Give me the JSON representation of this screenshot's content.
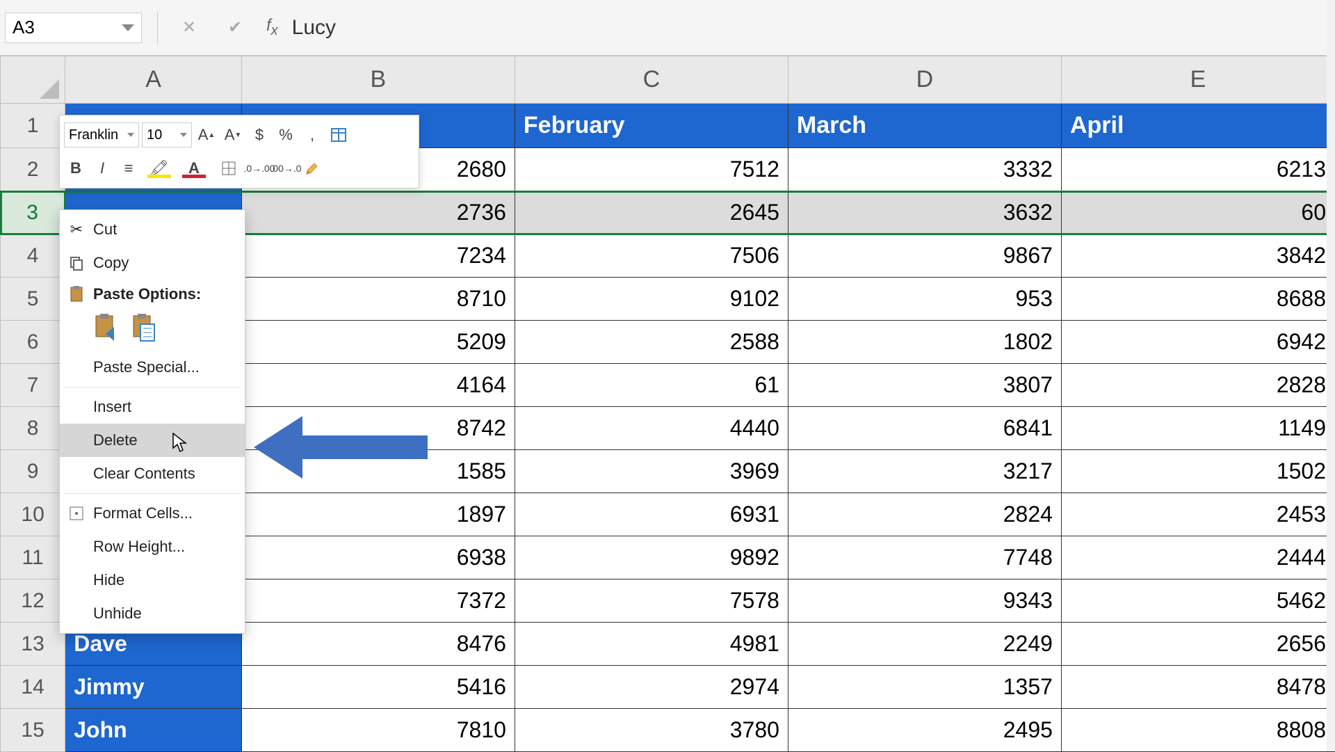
{
  "formula_bar": {
    "name_box": "A3",
    "formula_value": "Lucy"
  },
  "columns": [
    "A",
    "B",
    "C",
    "D",
    "E"
  ],
  "header_row": {
    "a": "",
    "b": "",
    "c": "February",
    "d": "March",
    "e": "April"
  },
  "rows": [
    {
      "n": "1"
    },
    {
      "n": "2",
      "b": "2680",
      "c": "7512",
      "d": "3332",
      "e": "6213"
    },
    {
      "n": "3",
      "b": "2736",
      "c": "2645",
      "d": "3632",
      "e": "60"
    },
    {
      "n": "4",
      "b": "7234",
      "c": "7506",
      "d": "9867",
      "e": "3842"
    },
    {
      "n": "5",
      "b": "8710",
      "c": "9102",
      "d": "953",
      "e": "8688"
    },
    {
      "n": "6",
      "b": "5209",
      "c": "2588",
      "d": "1802",
      "e": "6942"
    },
    {
      "n": "7",
      "b": "4164",
      "c": "61",
      "d": "3807",
      "e": "2828"
    },
    {
      "n": "8",
      "b": "8742",
      "c": "4440",
      "d": "6841",
      "e": "1149"
    },
    {
      "n": "9",
      "b": "1585",
      "c": "3969",
      "d": "3217",
      "e": "1502"
    },
    {
      "n": "10",
      "b": "1897",
      "c": "6931",
      "d": "2824",
      "e": "2453"
    },
    {
      "n": "11",
      "b": "6938",
      "c": "9892",
      "d": "7748",
      "e": "2444"
    },
    {
      "n": "12",
      "b": "7372",
      "c": "7578",
      "d": "9343",
      "e": "5462"
    },
    {
      "n": "13",
      "a": "Dave",
      "b": "8476",
      "c": "4981",
      "d": "2249",
      "e": "2656"
    },
    {
      "n": "14",
      "a": "Jimmy",
      "b": "5416",
      "c": "2974",
      "d": "1357",
      "e": "8478"
    },
    {
      "n": "15",
      "a": "John",
      "b": "7810",
      "c": "3780",
      "d": "2495",
      "e": "8808"
    }
  ],
  "mini_toolbar": {
    "font": "Franklin",
    "size": "10"
  },
  "context_menu": {
    "cut": "Cut",
    "copy": "Copy",
    "paste_options": "Paste Options:",
    "paste_special": "Paste Special...",
    "insert": "Insert",
    "delete": "Delete",
    "clear_contents": "Clear Contents",
    "format_cells": "Format Cells...",
    "row_height": "Row Height...",
    "hide": "Hide",
    "unhide": "Unhide"
  }
}
